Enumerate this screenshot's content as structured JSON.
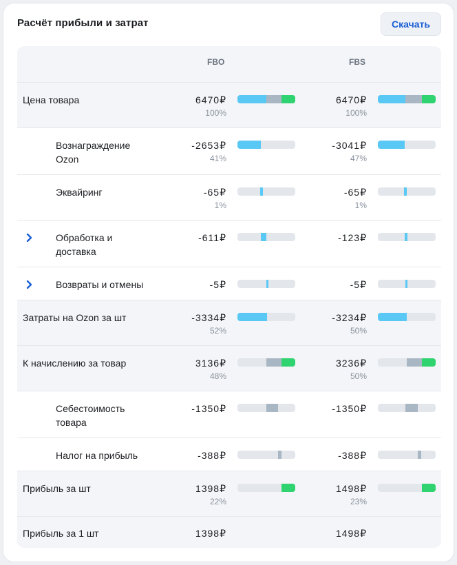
{
  "title": "Расчёт прибыли и затрат",
  "download_label": "Скачать",
  "columns": {
    "fbo": "FBO",
    "fbs": "FBS"
  },
  "colors": {
    "commission": "#5ac8f5",
    "cost": "#a9b6c4",
    "profit": "#2fd36f",
    "track": "#e3e7ec",
    "link": "#1a5fd6"
  },
  "rows": [
    {
      "label": "Цена товара",
      "fbo_value": "6470₽",
      "fbo_pct": "100%",
      "fbs_value": "6470₽",
      "fbs_pct": "100%"
    },
    {
      "label": "Вознаграждение Ozon",
      "fbo_value": "-2653₽",
      "fbo_pct": "41%",
      "fbs_value": "-3041₽",
      "fbs_pct": "47%"
    },
    {
      "label": "Эквайринг",
      "fbo_value": "-65₽",
      "fbo_pct": "1%",
      "fbs_value": "-65₽",
      "fbs_pct": "1%"
    },
    {
      "label": "Обработка и доставка",
      "fbo_value": "-611₽",
      "fbo_pct": "",
      "fbs_value": "-123₽",
      "fbs_pct": "",
      "icon": "chevron-right-icon"
    },
    {
      "label": "Возвраты и отмены",
      "fbo_value": "-5₽",
      "fbo_pct": "",
      "fbs_value": "-5₽",
      "fbs_pct": "",
      "icon": "chevron-right-icon"
    },
    {
      "label": "Затраты на Ozon за шт",
      "fbo_value": "-3334₽",
      "fbo_pct": "52%",
      "fbs_value": "-3234₽",
      "fbs_pct": "50%"
    },
    {
      "label": "К начислению за товар",
      "fbo_value": "3136₽",
      "fbo_pct": "48%",
      "fbs_value": "3236₽",
      "fbs_pct": "50%"
    },
    {
      "label": "Себестоимость товара",
      "fbo_value": "-1350₽",
      "fbo_pct": "",
      "fbs_value": "-1350₽",
      "fbs_pct": ""
    },
    {
      "label": "Налог на прибыль",
      "fbo_value": "-388₽",
      "fbo_pct": "",
      "fbs_value": "-388₽",
      "fbs_pct": ""
    },
    {
      "label": "Прибыль за шт",
      "fbo_value": "1398₽",
      "fbo_pct": "22%",
      "fbs_value": "1498₽",
      "fbs_pct": "23%"
    },
    {
      "label": "Прибыль за 1 шт",
      "fbo_value": "1398₽",
      "fbo_pct": "",
      "fbs_value": "1498₽",
      "fbs_pct": ""
    }
  ]
}
